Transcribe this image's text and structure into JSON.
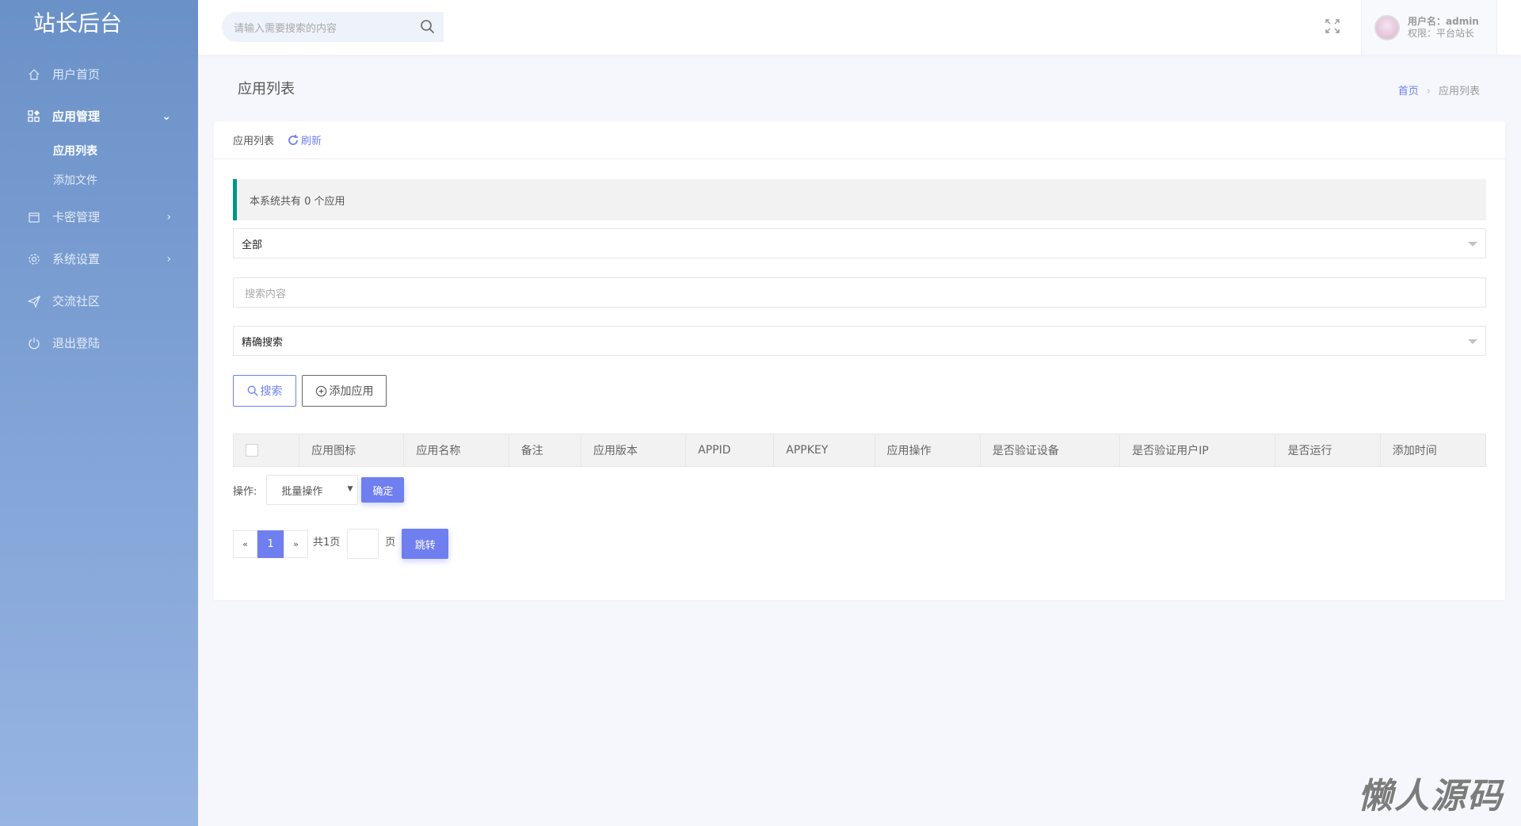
{
  "sidebar": {
    "logo": "站长后台",
    "items": [
      {
        "label": "用户首页",
        "icon": "home-icon"
      },
      {
        "label": "应用管理",
        "icon": "apps-icon",
        "sub": [
          {
            "label": "应用列表"
          },
          {
            "label": "添加文件"
          }
        ]
      },
      {
        "label": "卡密管理",
        "icon": "card-icon"
      },
      {
        "label": "系统设置",
        "icon": "gear-icon"
      },
      {
        "label": "交流社区",
        "icon": "send-icon"
      },
      {
        "label": "退出登陆",
        "icon": "power-icon"
      }
    ]
  },
  "header": {
    "search_placeholder": "请输入需要搜索的内容",
    "user_label": "用户名：admin",
    "role_label": "权限：平台站长"
  },
  "page": {
    "title": "应用列表",
    "breadcrumb": [
      "首页",
      "应用列表"
    ]
  },
  "card": {
    "tab": "应用列表",
    "refresh": "刷新",
    "notice": "本系统共有 0 个应用",
    "filter_select": "全部",
    "search_placeholder": "搜索内容",
    "mode_select": "精确搜索",
    "search_btn": "搜索",
    "add_btn": "添加应用",
    "columns": [
      "应用图标",
      "应用名称",
      "备注",
      "应用版本",
      "APPID",
      "APPKEY",
      "应用操作",
      "是否验证设备",
      "是否验证用户IP",
      "是否运行",
      "添加时间"
    ],
    "ops_label": "操作:",
    "batch_select": "批量操作",
    "confirm": "确定",
    "pager": {
      "prev": "«",
      "current": "1",
      "next": "»",
      "total": "共1页",
      "page_unit": "页",
      "jump": "跳转"
    }
  },
  "watermark": "懒人源码",
  "colors": {
    "accent": "#6f7ff0",
    "notice_border": "#009688",
    "sidebar_top": "#6a91c8",
    "sidebar_bottom": "#97b4e3"
  }
}
